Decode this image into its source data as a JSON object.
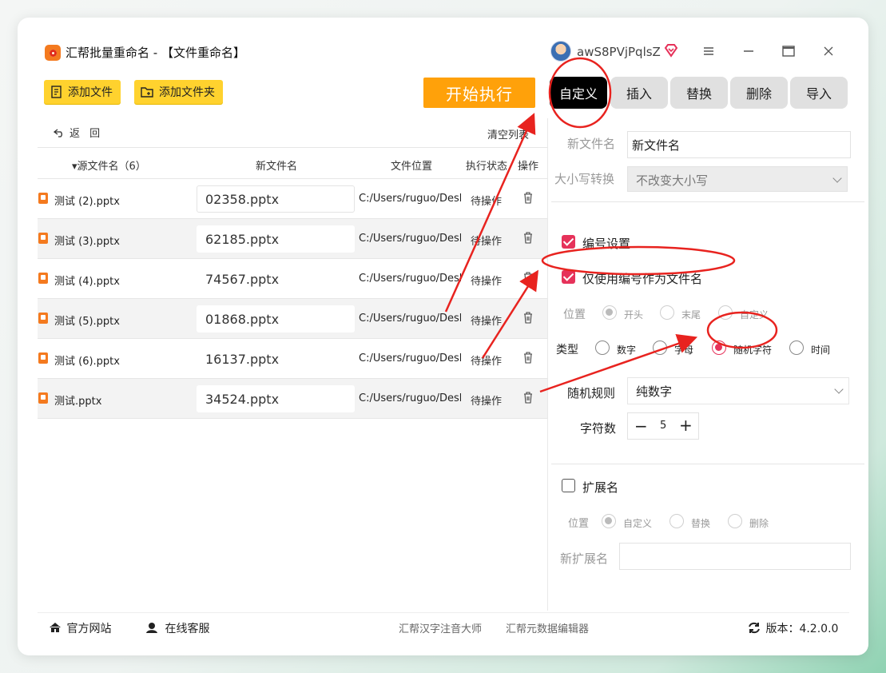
{
  "window": {
    "title": "汇帮批量重命名 - 【文件重命名】"
  },
  "user": {
    "name": "awS8PVjPqlsZ"
  },
  "toolbar": {
    "add_file": "添加文件",
    "add_folder": "添加文件夹",
    "start": "开始执行"
  },
  "tabs": [
    {
      "label": "自定义",
      "active": true
    },
    {
      "label": "插入"
    },
    {
      "label": "替换"
    },
    {
      "label": "删除"
    },
    {
      "label": "导入"
    }
  ],
  "list": {
    "back": "返 回",
    "clear": "清空列表",
    "headers": {
      "source": "▾源文件名（6）",
      "new": "新文件名",
      "location": "文件位置",
      "status": "执行状态",
      "action": "操作"
    },
    "rows": [
      {
        "source": "测试 (2).pptx",
        "new": "02358.pptx",
        "location": "C:/Users/ruguo/Desktop",
        "status": "待操作"
      },
      {
        "source": "测试 (3).pptx",
        "new": "62185.pptx",
        "location": "C:/Users/ruguo/Desktop",
        "status": "待操作"
      },
      {
        "source": "测试 (4).pptx",
        "new": "74567.pptx",
        "location": "C:/Users/ruguo/Desktop",
        "status": "待操作"
      },
      {
        "source": "测试 (5).pptx",
        "new": "01868.pptx",
        "location": "C:/Users/ruguo/Desktop",
        "status": "待操作"
      },
      {
        "source": "测试 (6).pptx",
        "new": "16137.pptx",
        "location": "C:/Users/ruguo/Desktop",
        "status": "待操作"
      },
      {
        "source": "测试.pptx",
        "new": "34524.pptx",
        "location": "C:/Users/ruguo/Desktop",
        "status": "待操作"
      }
    ]
  },
  "panel": {
    "new_name_label": "新文件名",
    "new_name_value": "新文件名",
    "case_label": "大小写转换",
    "case_value": "不改变大小写",
    "numbering_label": "编号设置",
    "numbering_checked": true,
    "only_number_label": "仅使用编号作为文件名",
    "only_number_checked": true,
    "position_label": "位置",
    "position_options": [
      "开头",
      "末尾",
      "自定义"
    ],
    "type_label": "类型",
    "type_options": [
      "数字",
      "字母",
      "随机字符",
      "时间"
    ],
    "type_selected": "随机字符",
    "random_rule_label": "随机规则",
    "random_rule_value": "纯数字",
    "char_count_label": "字符数",
    "char_count_value": "5",
    "extension_label": "扩展名",
    "extension_checked": false,
    "ext_position_label": "位置",
    "ext_position_options": [
      "自定义",
      "替换",
      "删除"
    ],
    "new_ext_label": "新扩展名",
    "new_ext_value": ""
  },
  "footer": {
    "website": "官方网站",
    "service": "在线客服",
    "app1": "汇帮汉字注音大师",
    "app2": "汇帮元数据编辑器",
    "version_label": "版本：",
    "version": "4.2.0.0"
  },
  "colors": {
    "accent": "#e6325a",
    "yellow": "#ffd22e",
    "orange": "#ffa10a",
    "annotation": "#e8231f"
  }
}
